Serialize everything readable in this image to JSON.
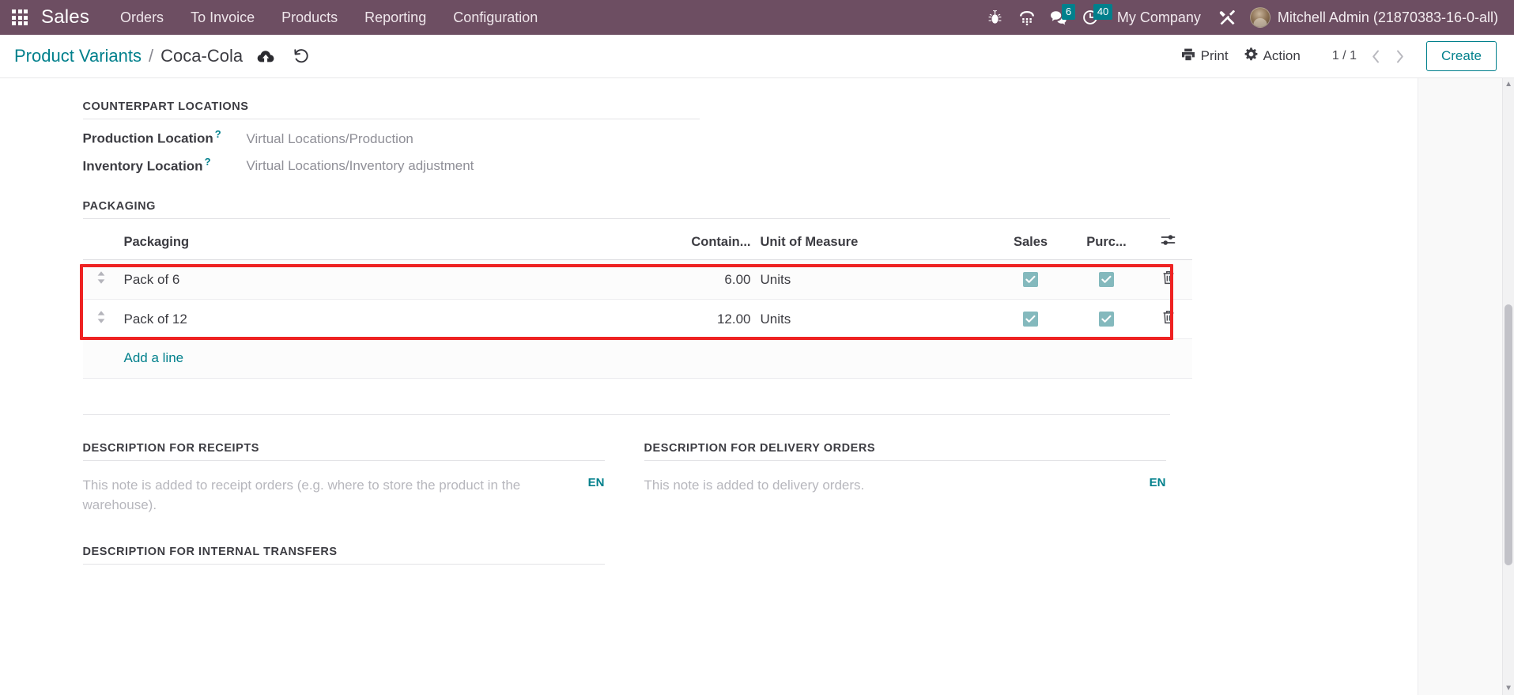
{
  "navbar": {
    "apps_icon": "apps-grid-icon",
    "brand": "Sales",
    "menu_items": [
      {
        "label": "Orders"
      },
      {
        "label": "To Invoice"
      },
      {
        "label": "Products"
      },
      {
        "label": "Reporting"
      },
      {
        "label": "Configuration"
      }
    ],
    "systray": [
      {
        "name": "bug-icon",
        "badge": ""
      },
      {
        "name": "phone-keypad-icon",
        "badge": ""
      },
      {
        "name": "messaging-icon",
        "badge": "6"
      },
      {
        "name": "activities-clock-icon",
        "badge": "40"
      }
    ],
    "company": "My Company",
    "debug_icon": "developer-tools-icon",
    "user_name": "Mitchell Admin (21870383-16-0-all)",
    "accent_bg": "#6d4e62",
    "badge_color": "#01808c"
  },
  "control_panel": {
    "breadcrumb_parent": "Product Variants",
    "breadcrumb_separator": "/",
    "breadcrumb_current": "Coca-Cola",
    "save_icon": "cloud-upload-icon",
    "discard_icon": "undo-icon",
    "print_label": "Print",
    "print_icon": "printer-icon",
    "action_label": "Action",
    "action_icon": "gear-icon",
    "pager": "1 / 1",
    "prev_icon": "chevron-left-icon",
    "next_icon": "chevron-right-icon",
    "create_label": "Create",
    "accent": "#01808c"
  },
  "form": {
    "counterpart": {
      "title": "COUNTERPART LOCATIONS",
      "fields": [
        {
          "label": "Production Location",
          "tooltip": "?",
          "value": "Virtual Locations/Production"
        },
        {
          "label": "Inventory Location",
          "tooltip": "?",
          "value": "Virtual Locations/Inventory adjustment"
        }
      ]
    },
    "packaging": {
      "title": "PACKAGING",
      "columns": {
        "packaging": "Packaging",
        "contained": "Contain...",
        "uom": "Unit of Measure",
        "sales": "Sales",
        "purchase": "Purc...",
        "optional_toggle_icon": "column-options-sliders-icon"
      },
      "rows": [
        {
          "handle_icon": "drag-handle-icon",
          "name": "Pack of 6",
          "contained_qty": "6.00",
          "uom": "Units",
          "sales": true,
          "purchase": true,
          "delete_icon": "trash-icon"
        },
        {
          "handle_icon": "drag-handle-icon",
          "name": "Pack of 12",
          "contained_qty": "12.00",
          "uom": "Units",
          "sales": true,
          "purchase": true,
          "delete_icon": "trash-icon"
        }
      ],
      "add_line_label": "Add a line",
      "highlight_color": "#ee2222",
      "checkbox_color": "#84b9bd"
    },
    "description_receipts": {
      "title": "DESCRIPTION FOR RECEIPTS",
      "placeholder": "This note is added to receipt orders (e.g. where to store the product in the warehouse).",
      "lang": "EN"
    },
    "description_delivery": {
      "title": "DESCRIPTION FOR DELIVERY ORDERS",
      "placeholder": "This note is added to delivery orders.",
      "lang": "EN"
    },
    "description_internal": {
      "title": "DESCRIPTION FOR INTERNAL TRANSFERS"
    }
  }
}
